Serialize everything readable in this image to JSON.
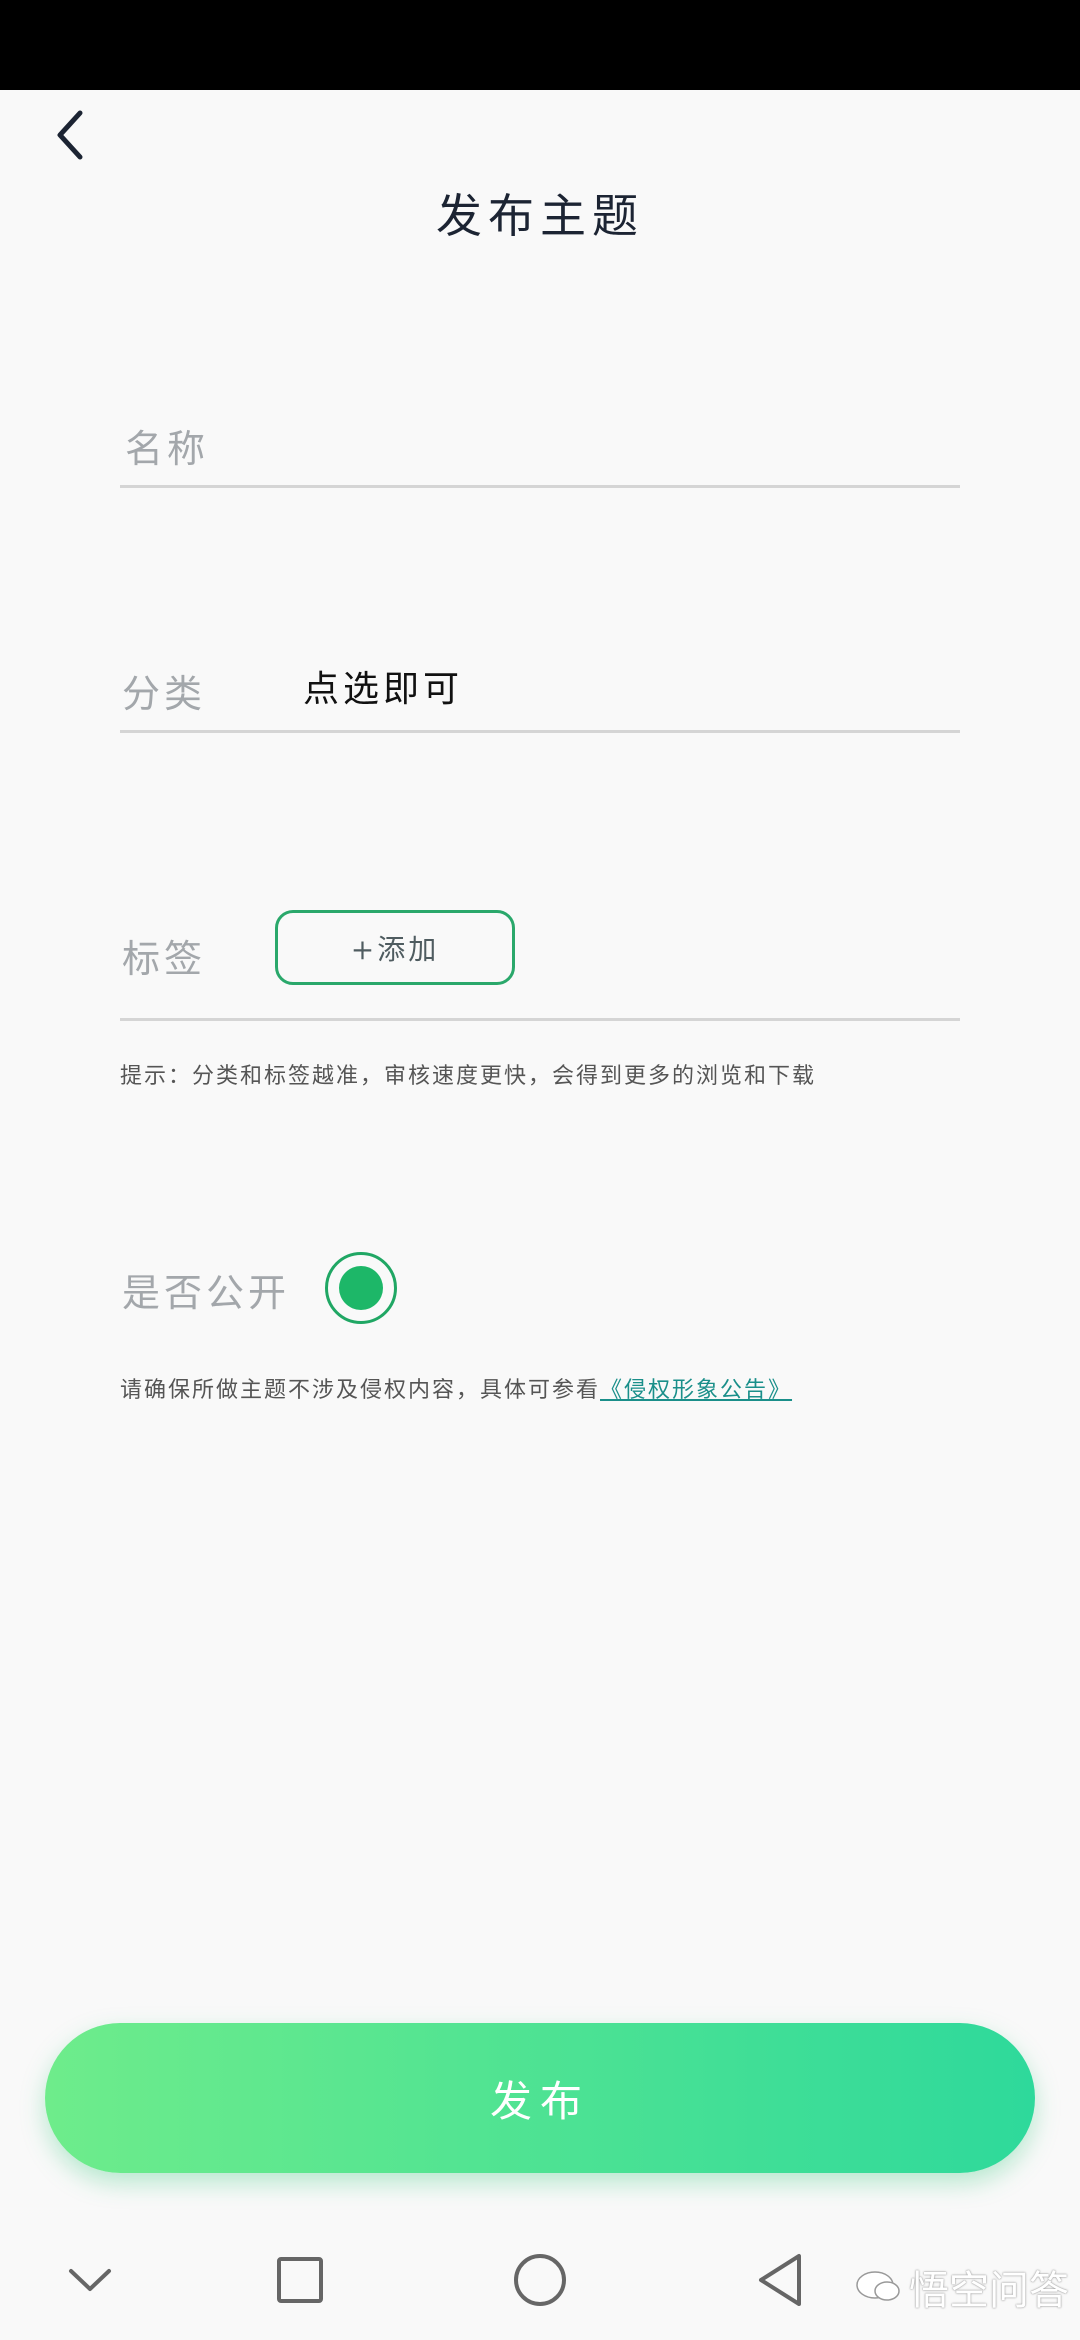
{
  "header": {
    "title": "发布主题"
  },
  "form": {
    "name": {
      "placeholder": "名称"
    },
    "category": {
      "label": "分类",
      "value": "点选即可"
    },
    "tags": {
      "label": "标签",
      "add_label": "+添加"
    },
    "hint": "提示：分类和标签越准，审核速度更快，会得到更多的浏览和下载",
    "public": {
      "label": "是否公开",
      "checked": true
    },
    "notice": {
      "text": "请确保所做主题不涉及侵权内容，具体可参看",
      "link_text": "《侵权形象公告》"
    }
  },
  "publish_button": {
    "label": "发布"
  },
  "watermark": {
    "text": "悟空问答"
  },
  "colors": {
    "accent": "#1db768",
    "gradient_start": "#6eec8b",
    "gradient_end": "#2ed99b"
  },
  "icons": [
    "chevron-left-icon",
    "chevron-down-icon",
    "square-icon",
    "circle-icon",
    "triangle-left-icon",
    "speech-bubble-icon"
  ]
}
